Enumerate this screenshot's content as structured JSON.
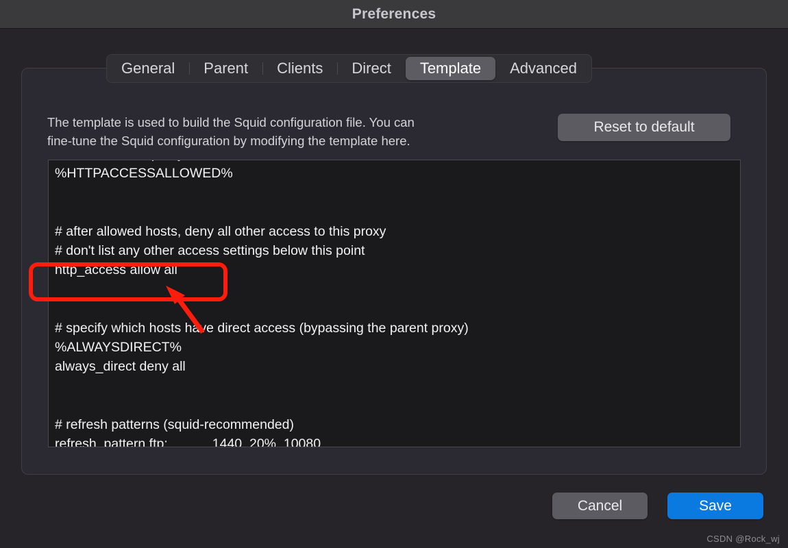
{
  "window": {
    "title": "Preferences"
  },
  "tabs": [
    {
      "label": "General",
      "active": false
    },
    {
      "label": "Parent",
      "active": false
    },
    {
      "label": "Clients",
      "active": false
    },
    {
      "label": "Direct",
      "active": false
    },
    {
      "label": "Template",
      "active": true
    },
    {
      "label": "Advanced",
      "active": false
    }
  ],
  "panel": {
    "description": "The template is used to build the Squid configuration file.  You can\nfine-tune the Squid configuration by modifying the template here.",
    "reset_label": "Reset to default",
    "template_text": "# Access to this proxy server\n%HTTPACCESSALLOWED%\n\n\n# after allowed hosts, deny all other access to this proxy\n# don't list any other access settings below this point\nhttp_access allow all\n\n\n# specify which hosts have direct access (bypassing the parent proxy)\n%ALWAYSDIRECT%\nalways_direct deny all\n\n\n# refresh patterns (squid-recommended)\nrefresh_pattern ftp:            1440  20%  10080"
  },
  "footer": {
    "cancel_label": "Cancel",
    "save_label": "Save"
  },
  "annotation": {
    "highlighted_line": "http_access allow all",
    "color": "#fc1d0c"
  },
  "watermark": {
    "text": "CSDN @Rock_wj"
  }
}
